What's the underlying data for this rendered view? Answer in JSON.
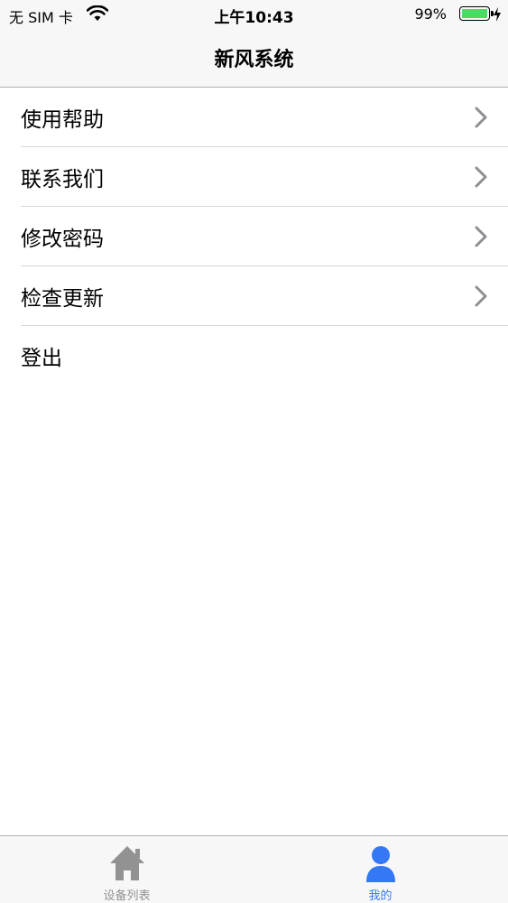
{
  "status_bar": {
    "carrier": "无 SIM 卡",
    "time": "上午10:43",
    "battery_percent": "99%",
    "battery_level": 0.99,
    "battery_color": "#4cd964"
  },
  "nav": {
    "title": "新风系统"
  },
  "menu": {
    "items": [
      {
        "label": "使用帮助",
        "icon": "chevron-right-icon"
      },
      {
        "label": "联系我们",
        "icon": "chevron-right-icon"
      },
      {
        "label": "修改密码",
        "icon": "chevron-right-icon"
      },
      {
        "label": "检查更新",
        "icon": "chevron-right-icon"
      },
      {
        "label": "登出"
      }
    ]
  },
  "tabbar": {
    "tabs": [
      {
        "label": "设备列表",
        "icon": "home-icon",
        "selected": false,
        "color": "#929292"
      },
      {
        "label": "我的",
        "icon": "person-icon",
        "selected": true,
        "color": "#3478f6"
      }
    ]
  }
}
